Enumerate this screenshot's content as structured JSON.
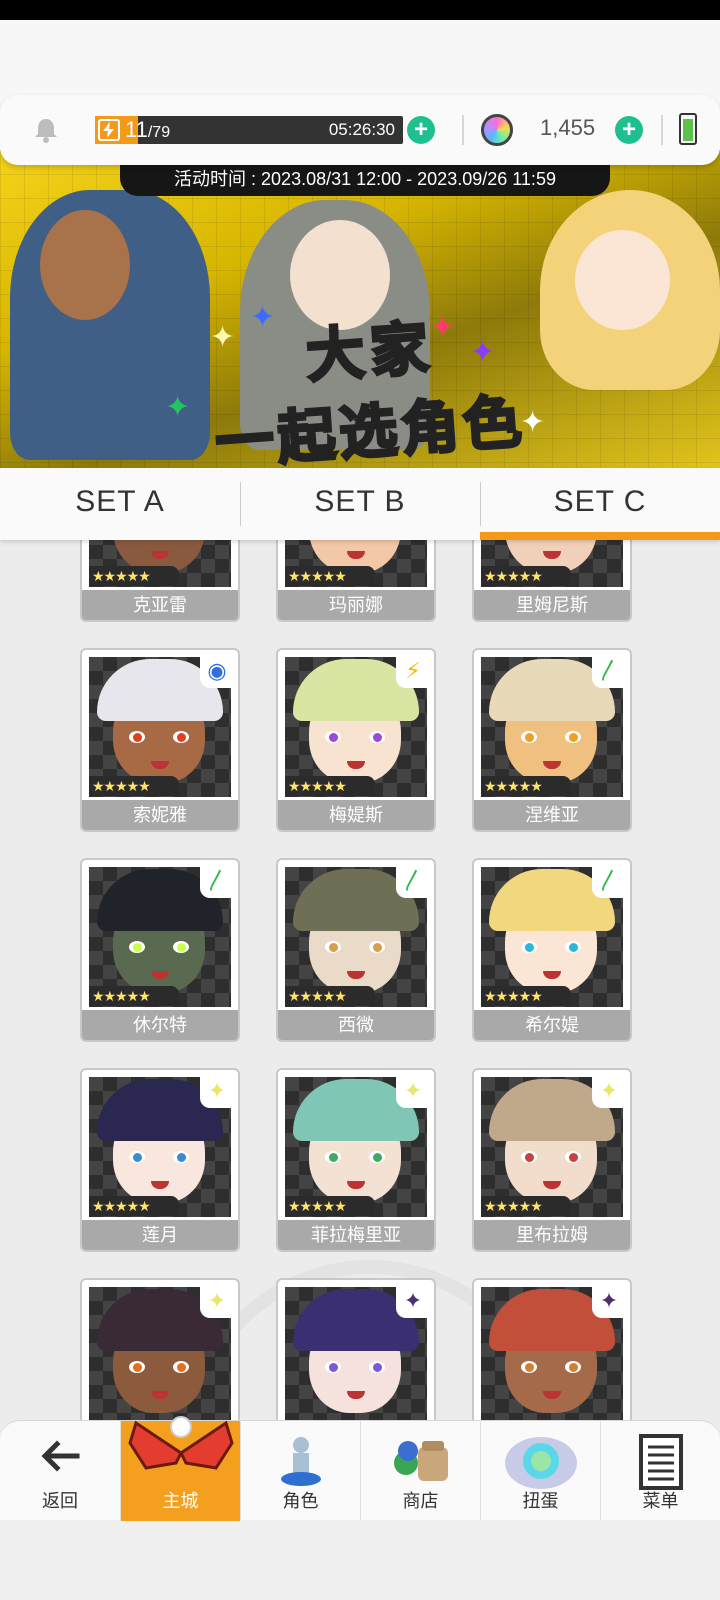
{
  "resources": {
    "stamina_current": "11",
    "stamina_max": "/79",
    "stamina_fraction": 0.139,
    "stamina_timer": "05:26:30",
    "gem_count": "1,455"
  },
  "banner": {
    "event_time": "活动时间 : 2023.08/31 12:00 - 2023.09/26 11:59",
    "title_line1": "大家",
    "title_line2": "一起选角色"
  },
  "tabs": [
    {
      "label": "SET A"
    },
    {
      "label": "SET B"
    },
    {
      "label": "SET C"
    }
  ],
  "characters": [
    {
      "name": "克亚雷",
      "stars": "★★★★★",
      "element": ""
    },
    {
      "name": "玛丽娜",
      "stars": "★★★★★",
      "element": ""
    },
    {
      "name": "里姆尼斯",
      "stars": "★★★★★",
      "element": ""
    },
    {
      "name": "索妮雅",
      "stars": "★★★★★",
      "element": "water-icon"
    },
    {
      "name": "梅媞斯",
      "stars": "★★★★★",
      "element": "lightning-icon"
    },
    {
      "name": "涅维亚",
      "stars": "★★★★★",
      "element": "wind-icon"
    },
    {
      "name": "休尔特",
      "stars": "★★★★★",
      "element": "wind-icon"
    },
    {
      "name": "西微",
      "stars": "★★★★★",
      "element": "wind-icon"
    },
    {
      "name": "希尔媞",
      "stars": "★★★★★",
      "element": "wind-icon"
    },
    {
      "name": "莲月",
      "stars": "★★★★★",
      "element": "light-icon"
    },
    {
      "name": "菲拉梅里亚",
      "stars": "★★★★★",
      "element": "light-icon"
    },
    {
      "name": "里布拉姆",
      "stars": "★★★★★",
      "element": "light-icon"
    },
    {
      "name": "",
      "stars": "",
      "element": "light-icon"
    },
    {
      "name": "",
      "stars": "",
      "element": "dark-icon"
    },
    {
      "name": "",
      "stars": "",
      "element": "dark-icon"
    }
  ],
  "nav": {
    "back": "返回",
    "main": "主城",
    "character": "角色",
    "shop": "商店",
    "gacha": "扭蛋",
    "menu": "菜单"
  },
  "colors": {
    "accent": "#f39a1b",
    "plus": "#1fc08f",
    "card_label_bg": "#a9a9a9"
  }
}
